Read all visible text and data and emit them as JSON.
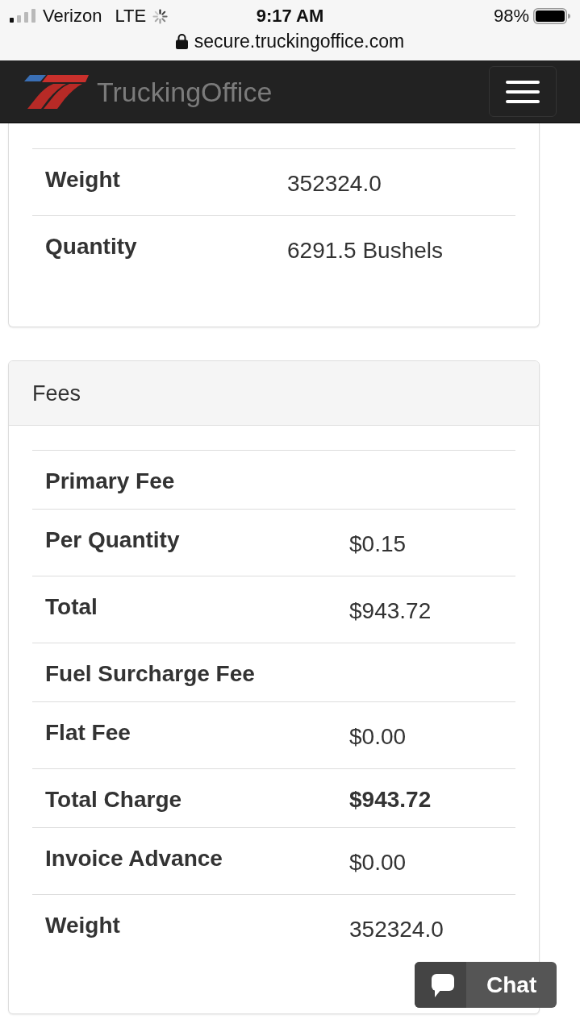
{
  "status_bar": {
    "carrier": "Verizon",
    "network": "LTE",
    "time": "9:17 AM",
    "battery": "98%"
  },
  "address_bar": {
    "url": "secure.truckingoffice.com"
  },
  "navbar": {
    "brand": "TruckingOffice"
  },
  "details_panel": {
    "rows": [
      {
        "label": "Weight",
        "value": "352324.0"
      },
      {
        "label": "Quantity",
        "value": "6291.5 Bushels"
      }
    ]
  },
  "fees_panel": {
    "title": "Fees",
    "rows": [
      {
        "kind": "group",
        "label": "Primary Fee"
      },
      {
        "kind": "item",
        "label": "Per Quantity",
        "value": "$0.15",
        "bold": false
      },
      {
        "kind": "item",
        "label": "Total",
        "value": "$943.72",
        "bold": false
      },
      {
        "kind": "group",
        "label": "Fuel Surcharge Fee"
      },
      {
        "kind": "item",
        "label": "Flat Fee",
        "value": "$0.00",
        "bold": false
      },
      {
        "kind": "item",
        "label": "Total Charge",
        "value": "$943.72",
        "bold": true
      },
      {
        "kind": "item",
        "label": "Invoice Advance",
        "value": "$0.00",
        "bold": false
      },
      {
        "kind": "item",
        "label": "Weight",
        "value": "352324.0",
        "bold": false
      }
    ]
  },
  "chat_button": {
    "label": "Chat"
  }
}
